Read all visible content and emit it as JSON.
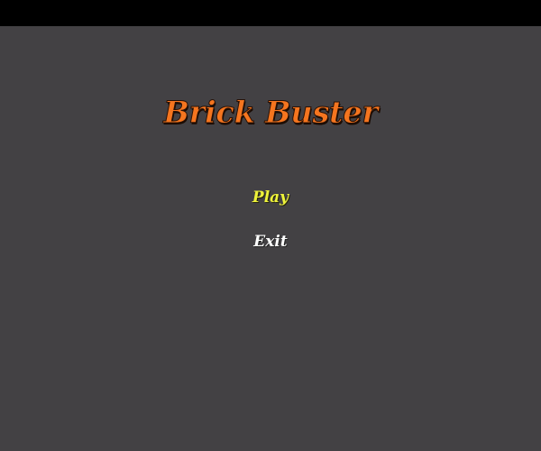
{
  "game": {
    "title": "Brick Buster",
    "menu": {
      "items": [
        {
          "label": "Play",
          "selected": true
        },
        {
          "label": "Exit",
          "selected": false
        }
      ]
    }
  },
  "colors": {
    "top_bar": "#000000",
    "background": "#434144",
    "title": "#f5751f",
    "selected_item": "#eef33a",
    "unselected_item": "#ffffff"
  }
}
